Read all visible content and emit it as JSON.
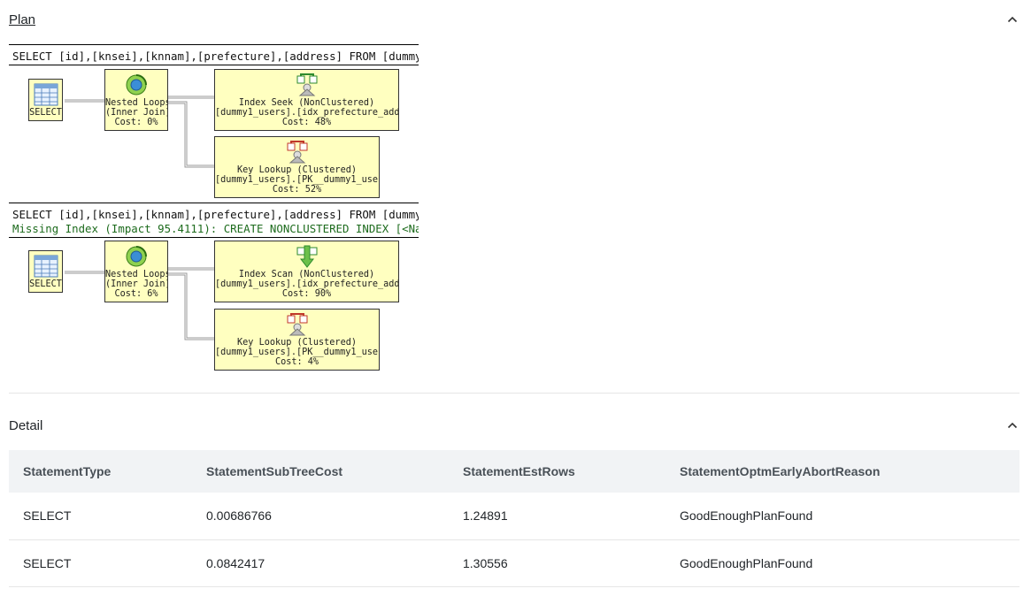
{
  "plan": {
    "title": "Plan",
    "statements": [
      {
        "sql": "SELECT [id],[knsei],[knnam],[prefecture],[address] FROM [dummy1_…",
        "missing_index": "",
        "ops": {
          "select": {
            "label": "SELECT"
          },
          "nested_loops": {
            "l1": "Nested Loops",
            "l2": "(Inner Join)",
            "cost": "Cost: 0%"
          },
          "access": {
            "l1": "Index Seek (NonClustered)",
            "l2": "[dummy1_users].[idx_prefecture_addr…",
            "cost": "Cost: 48%"
          },
          "lookup": {
            "l1": "Key Lookup (Clustered)",
            "l2": "[dummy1_users].[PK__dummy1_users]",
            "cost": "Cost: 52%"
          }
        }
      },
      {
        "sql": "SELECT [id],[knsei],[knnam],[prefecture],[address] FROM [dummy1_…",
        "missing_index": "Missing Index (Impact 95.4111): CREATE NONCLUSTERED INDEX [<Name…",
        "ops": {
          "select": {
            "label": "SELECT"
          },
          "nested_loops": {
            "l1": "Nested Loops",
            "l2": "(Inner Join)",
            "cost": "Cost: 6%"
          },
          "access": {
            "l1": "Index Scan (NonClustered)",
            "l2": "[dummy1_users].[idx_prefecture_addr…",
            "cost": "Cost: 90%"
          },
          "lookup": {
            "l1": "Key Lookup (Clustered)",
            "l2": "[dummy1_users].[PK__dummy1_users]",
            "cost": "Cost: 4%"
          }
        }
      }
    ]
  },
  "detail": {
    "title": "Detail",
    "columns": [
      "StatementType",
      "StatementSubTreeCost",
      "StatementEstRows",
      "StatementOptmEarlyAbortReason"
    ],
    "rows": [
      [
        "SELECT",
        "0.00686766",
        "1.24891",
        "GoodEnoughPlanFound"
      ],
      [
        "SELECT",
        "0.0842417",
        "1.30556",
        "GoodEnoughPlanFound"
      ]
    ]
  },
  "colors": {
    "operator_fill": "#ffffc0",
    "missing_index_text": "#1d6b1d",
    "table_header_bg": "#f1f3f5"
  }
}
